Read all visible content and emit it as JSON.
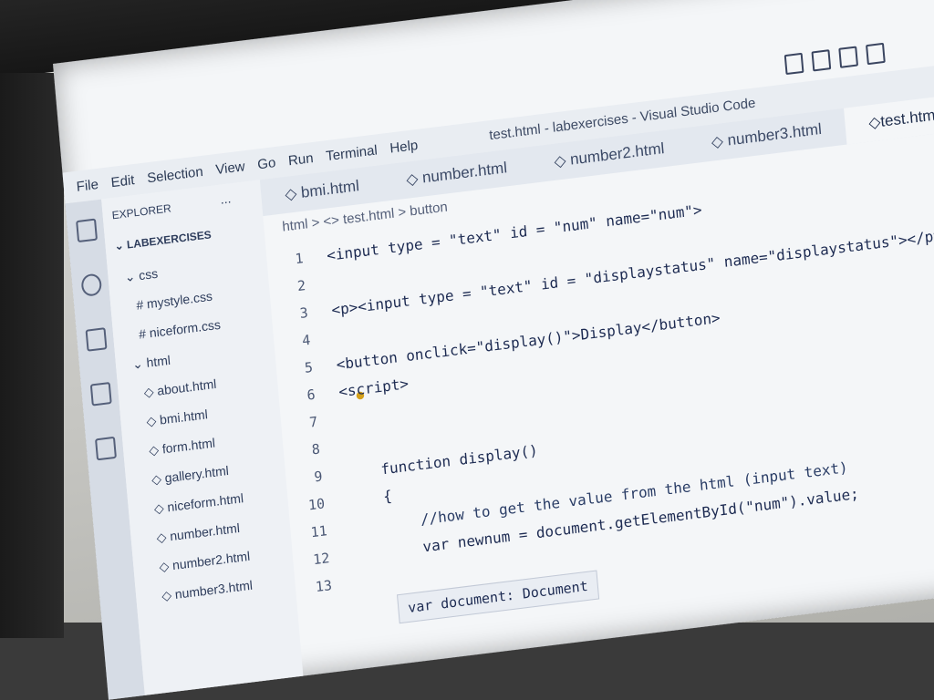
{
  "window": {
    "title": "test.html - labexercises - Visual Studio Code"
  },
  "menubar": [
    "File",
    "Edit",
    "Selection",
    "View",
    "Go",
    "Run",
    "Terminal",
    "Help"
  ],
  "explorer": {
    "header": "EXPLORER",
    "more": "...",
    "project": "LABEXERCISES",
    "items": [
      {
        "label": "css",
        "kind": "folder"
      },
      {
        "label": "mystyle.css",
        "kind": "css"
      },
      {
        "label": "niceform.css",
        "kind": "css"
      },
      {
        "label": "html",
        "kind": "folder"
      },
      {
        "label": "about.html",
        "kind": "html"
      },
      {
        "label": "bmi.html",
        "kind": "html"
      },
      {
        "label": "form.html",
        "kind": "html"
      },
      {
        "label": "gallery.html",
        "kind": "html"
      },
      {
        "label": "niceform.html",
        "kind": "html"
      },
      {
        "label": "number.html",
        "kind": "html"
      },
      {
        "label": "number2.html",
        "kind": "html"
      },
      {
        "label": "number3.html",
        "kind": "html"
      }
    ]
  },
  "tabs": [
    {
      "label": "bmi.html",
      "active": false
    },
    {
      "label": "number.html",
      "active": false
    },
    {
      "label": "number2.html",
      "active": false
    },
    {
      "label": "number3.html",
      "active": false
    },
    {
      "label": "test.html",
      "active": true
    }
  ],
  "breadcrumb": "html > <> test.html > button",
  "code_lines": [
    {
      "n": "1",
      "text": "<input type = \"text\" id = \"num\" name=\"num\">"
    },
    {
      "n": "2",
      "text": ""
    },
    {
      "n": "3",
      "text": "<p><input type = \"text\" id = \"displaystatus\" name=\"displaystatus\"></p>"
    },
    {
      "n": "4",
      "text": ""
    },
    {
      "n": "5",
      "text": "<button onclick=\"display()\">Display</button>"
    },
    {
      "n": "6",
      "text": "<script>"
    },
    {
      "n": "7",
      "text": ""
    },
    {
      "n": "8",
      "text": ""
    },
    {
      "n": "9",
      "text": "    function display()"
    },
    {
      "n": "10",
      "text": "    {"
    },
    {
      "n": "11",
      "text": "        //how to get the value from the html (input text)"
    },
    {
      "n": "12",
      "text": "        var newnum = document.getElementById(\"num\").value;"
    },
    {
      "n": "13",
      "text": ""
    }
  ],
  "tooltip": "var document: Document",
  "colors": {
    "keyword": "#1f3fb5",
    "selection": "#bcd4ff",
    "editor_bg": "#f4f6f8"
  }
}
